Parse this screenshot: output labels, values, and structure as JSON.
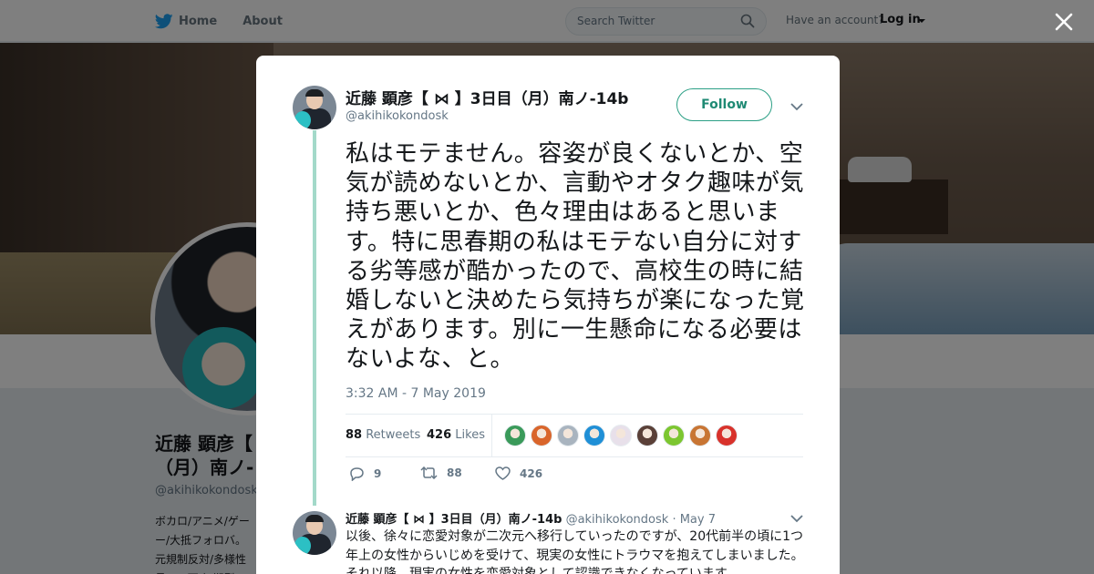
{
  "nav": {
    "home_label": "Home",
    "about_label": "About",
    "search_placeholder": "Search Twitter",
    "have_account": "Have an account?",
    "login_label": "Log in"
  },
  "profile": {
    "name_line1": "近藤 顕彦【",
    "name_line2": "（月）南ノ-",
    "handle": "@akihikokondosk",
    "bio": "ボカロ/アニメ/ゲー ー/大抵フォロバ。 元規制反対/多様性 員/DM可/初期型C"
  },
  "tweet": {
    "display_name": "近藤 顕彦【 ⋈ 】3日目（月）南ノ-14b",
    "handle": "@akihikokondosk",
    "follow_label": "Follow",
    "text": "私はモテません。容姿が良くないとか、空気が読めないとか、言動やオタク趣味が気持ち悪いとか、色々理由はあると思います。特に思春期の私はモテない自分に対する劣等感が酷かったので、高校生の時に結婚しないと決めたら気持ちが楽になった覚えがあります。別に一生懸命になる必要はないよな、と。",
    "timestamp": "3:32 AM - 7 May 2019",
    "retweets_count": "88",
    "retweets_label": "Retweets",
    "likes_count": "426",
    "likes_label": "Likes",
    "liker_colors": [
      "#3a9a5a",
      "#d9652b",
      "#a9b4bf",
      "#1f8fd6",
      "#e8e0ea",
      "#5a4038",
      "#7cc630",
      "#c87533",
      "#d8322b"
    ],
    "actions": {
      "replies": "9",
      "retweets": "88",
      "likes": "426"
    }
  },
  "reply": {
    "display_name": "近藤 顕彦【 ⋈ 】3日目（月）南ノ-14b",
    "handle": "@akihikokondosk",
    "separator": " · ",
    "date": "May 7",
    "text": "以後、徐々に恋愛対象が二次元へ移行していったのですが、20代前半の頃に1つ年上の女性からいじめを受けて、現実の女性にトラウマを抱えてしまいました。それ以降、現実の女性を恋愛対象として認識できなくなっています。"
  },
  "colors": {
    "accent": "#2b9f85",
    "thread_line": "#a3d9c9",
    "twitter_blue": "#1da1f2"
  }
}
